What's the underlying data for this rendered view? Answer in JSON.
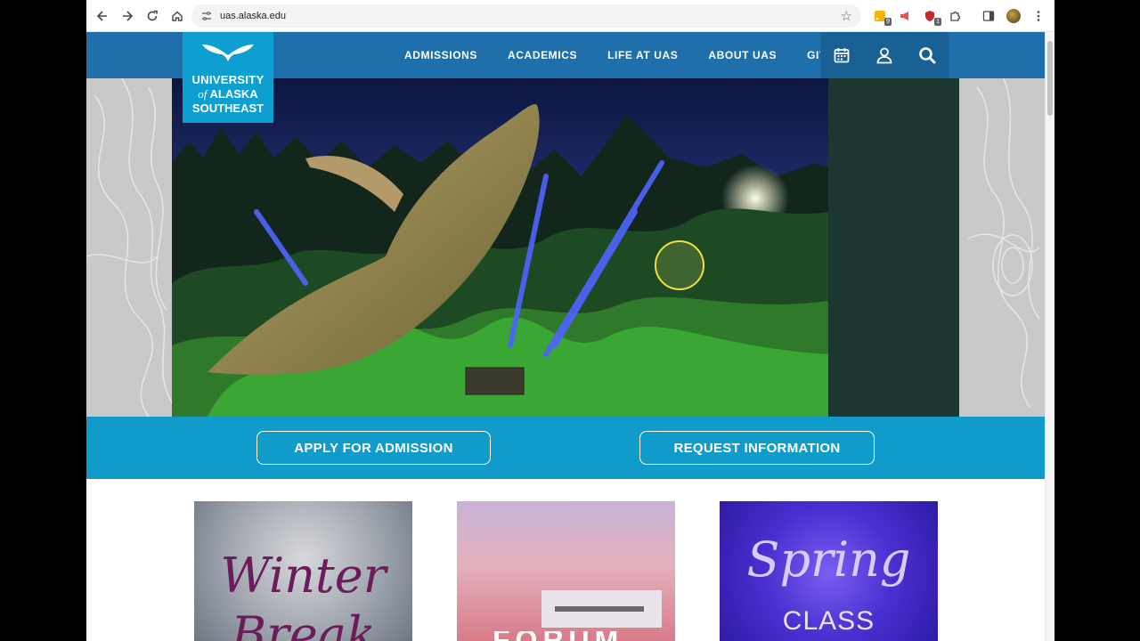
{
  "browser": {
    "url": "uas.alaska.edu",
    "extension_badges": [
      "9",
      "1"
    ]
  },
  "site": {
    "logo": {
      "line1": "UNIVERSITY",
      "line2_of": "of",
      "line2_rest": " ALASKA",
      "line3": "SOUTHEAST"
    },
    "nav": [
      {
        "label": "ADMISSIONS"
      },
      {
        "label": "ACADEMICS"
      },
      {
        "label": "LIFE AT UAS"
      },
      {
        "label": "ABOUT UAS"
      },
      {
        "label": "GIVE"
      }
    ],
    "utility_icons": [
      "calendar-icon",
      "user-icon",
      "search-icon"
    ]
  },
  "cta": {
    "apply_label": "APPLY FOR ADMISSION",
    "request_label": "REQUEST INFORMATION"
  },
  "cards": [
    {
      "line1": "Winter",
      "line2": "Break"
    },
    {
      "word": "FORUM"
    },
    {
      "line1": "Spring",
      "line2": "CLASS"
    }
  ],
  "colors": {
    "header_blue": "#1f6faa",
    "logo_teal": "#0f9ed0",
    "cta_band": "#119bcb"
  }
}
